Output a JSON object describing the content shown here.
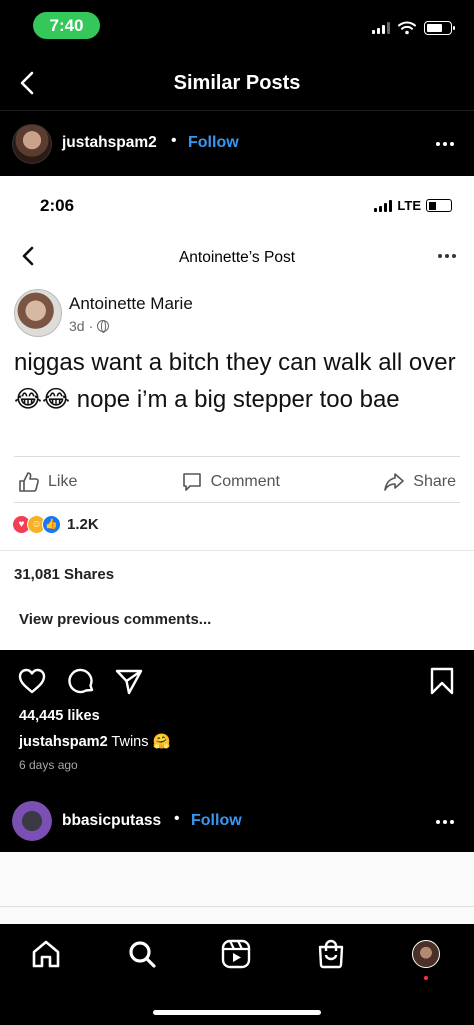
{
  "status_bar": {
    "time": "7:40"
  },
  "header": {
    "title": "Similar Posts"
  },
  "post": {
    "username": "justahspam2",
    "separator": "•",
    "follow_label": "Follow",
    "embedded": {
      "time": "2:06",
      "network": "LTE",
      "nav_title": "Antoinette’s Post",
      "author": "Antoinette Marie",
      "age": "3d",
      "meta_sep": "·",
      "text": "niggas want a bitch they can walk all over 😂😂 nope i’m a big stepper too bae",
      "actions": {
        "like": "Like",
        "comment": "Comment",
        "share": "Share"
      },
      "reaction_count": "1.2K",
      "shares": "31,081 Shares",
      "prev_comments": "View previous comments..."
    },
    "likes": "44,445 likes",
    "caption_user": "justahspam2",
    "caption_text": " Twins 🤗",
    "timestamp": "6 days ago"
  },
  "next_post": {
    "username": "bbasicputass",
    "separator": "•",
    "follow_label": "Follow"
  },
  "colors": {
    "accent": "#3897f0",
    "status_pill": "#34c759"
  },
  "icons": [
    "back-icon",
    "more-icon",
    "heart-icon",
    "comment-icon",
    "send-icon",
    "bookmark-icon",
    "home-icon",
    "search-icon",
    "reels-icon",
    "shop-icon"
  ]
}
